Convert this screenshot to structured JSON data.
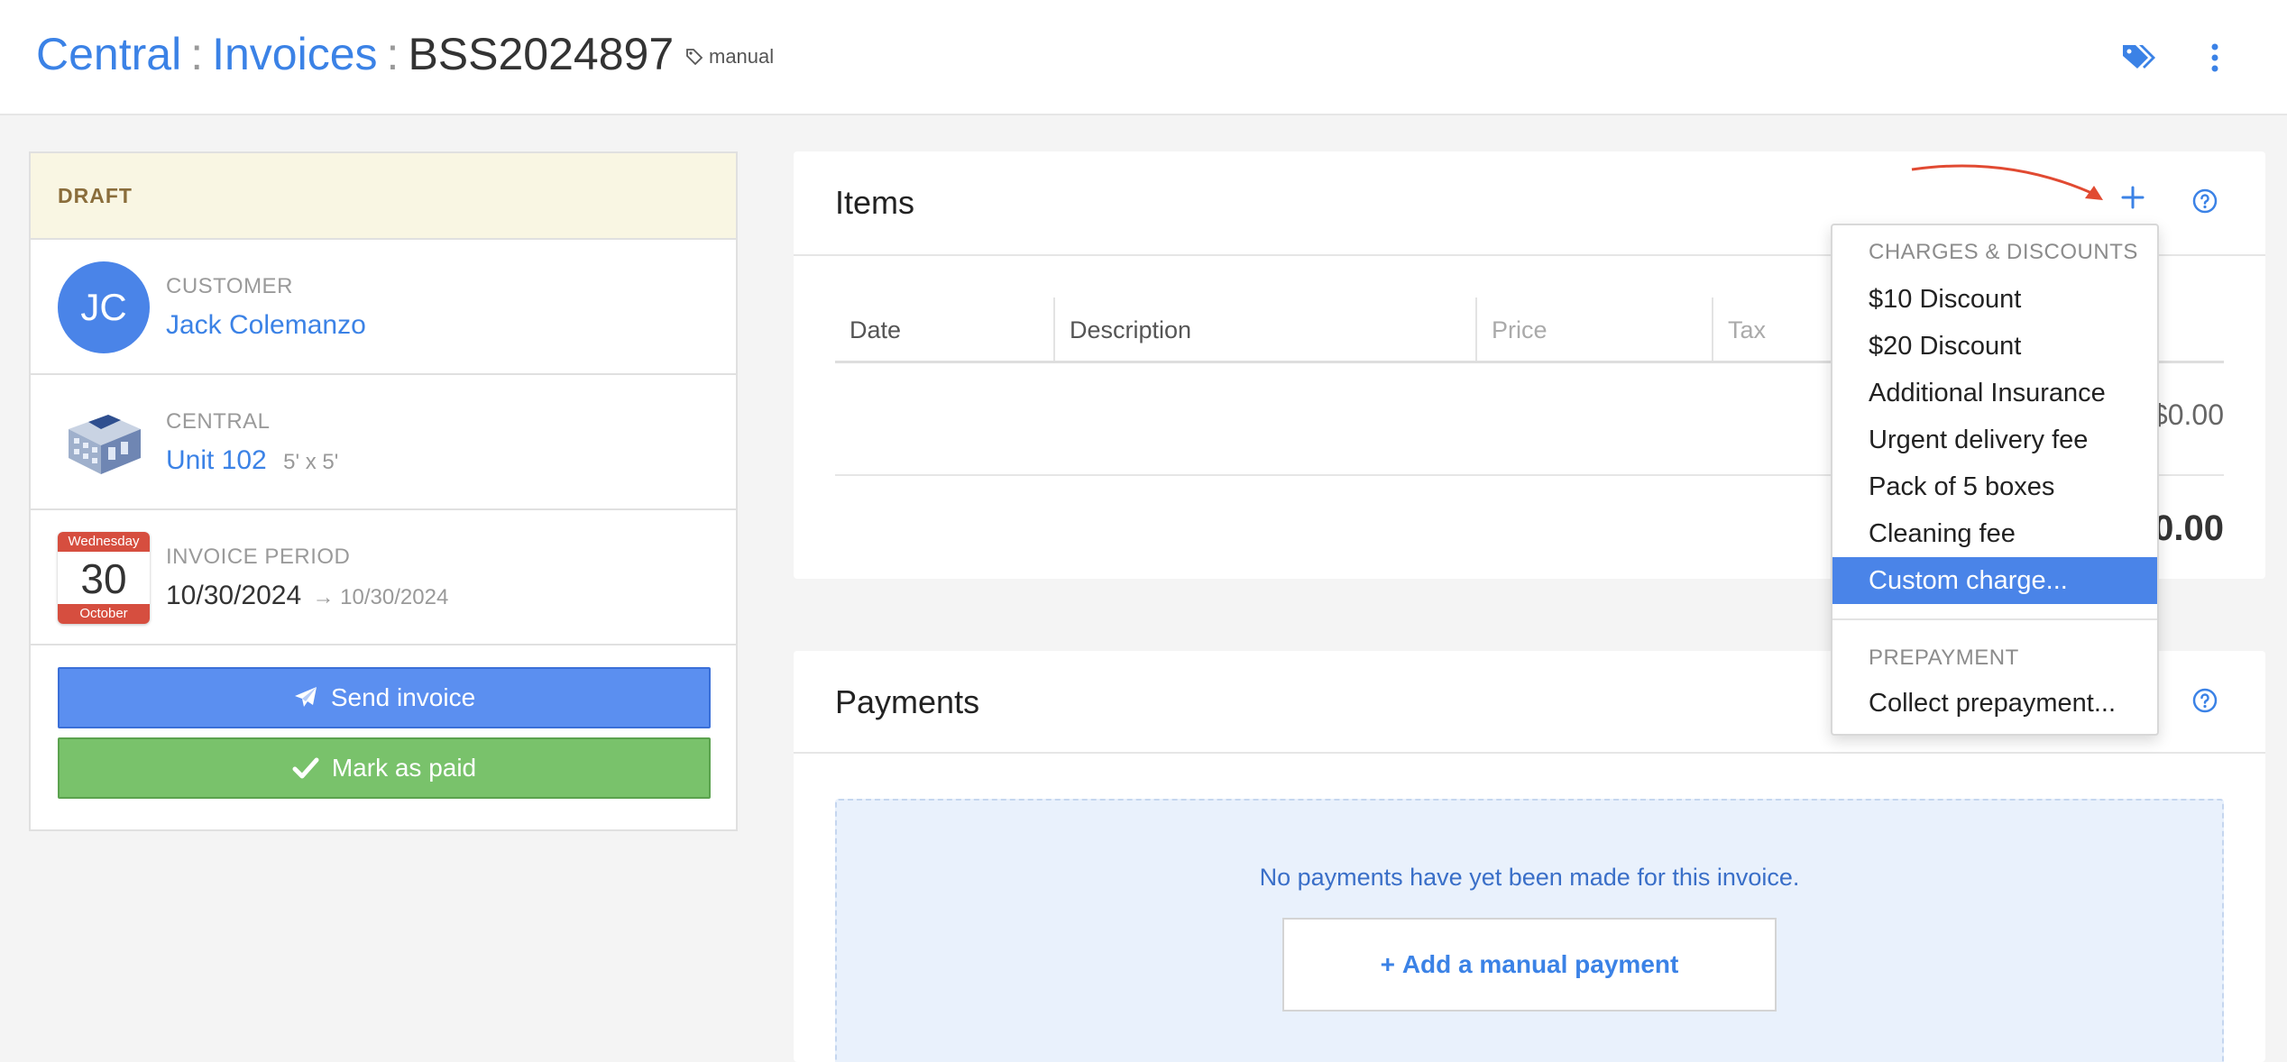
{
  "header": {
    "breadcrumbs": [
      "Central",
      "Invoices",
      "BSS2024897"
    ],
    "separator": ":",
    "tag": "manual"
  },
  "invoice": {
    "status": "DRAFT",
    "customer": {
      "label": "CUSTOMER",
      "initials": "JC",
      "name": "Jack Colemanzo"
    },
    "unit": {
      "label": "CENTRAL",
      "name": "Unit 102",
      "size": "5' x 5'"
    },
    "period": {
      "label": "INVOICE PERIOD",
      "weekday": "Wednesday",
      "day": "30",
      "month": "October",
      "start": "10/30/2024",
      "end_prefix": "→ ",
      "end": "10/30/2024"
    },
    "send_label": "Send invoice",
    "paid_label": "Mark as paid"
  },
  "items": {
    "title": "Items",
    "columns": [
      "Date",
      "Description",
      "Price",
      "Tax"
    ],
    "row_amount": "$0.00",
    "total": "0.00"
  },
  "menu": {
    "section1": "CHARGES & DISCOUNTS",
    "options": [
      "$10 Discount",
      "$20 Discount",
      "Additional Insurance",
      "Urgent delivery fee",
      "Pack of 5 boxes",
      "Cleaning fee",
      "Custom charge..."
    ],
    "active_option": "Custom charge...",
    "section2": "PREPAYMENT",
    "prepay": "Collect prepayment..."
  },
  "payments": {
    "title": "Payments",
    "empty_msg": "No payments have yet been made for this invoice.",
    "add_label": "Add a manual payment",
    "add_prefix": "+ "
  },
  "colors": {
    "accent": "#3b82e6",
    "send_button": "#5b8ff0",
    "paid_button": "#79c26b",
    "draft_bg": "#f9f6e3",
    "annotation_arrow": "#e14a32"
  },
  "icons": [
    "tag-icon",
    "tags-icon",
    "more-vertical-icon",
    "building-icon",
    "calendar-icon",
    "paper-plane-icon",
    "check-icon",
    "plus-icon",
    "help-circle-icon"
  ]
}
